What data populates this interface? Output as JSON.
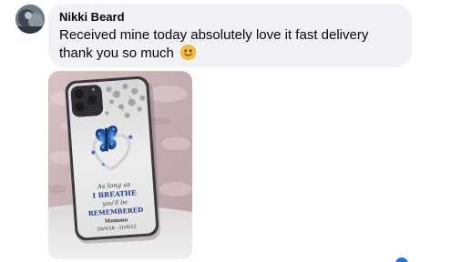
{
  "comment": {
    "author": "Nikki Beard",
    "text": "Received mine today absolutely love it fast delivery thank you so much",
    "emoji": "smiling-face-emoji"
  },
  "photo": {
    "case_text": {
      "line1": "As long as",
      "line2": "I BREATHE",
      "line3": "you'll be",
      "line4": "REMEMBERED",
      "line5": "Mumma",
      "line6": "28/4/38 - 20/6/22"
    }
  },
  "reaction": {
    "icon": "like-reaction-icon",
    "color": "#1877f2"
  }
}
